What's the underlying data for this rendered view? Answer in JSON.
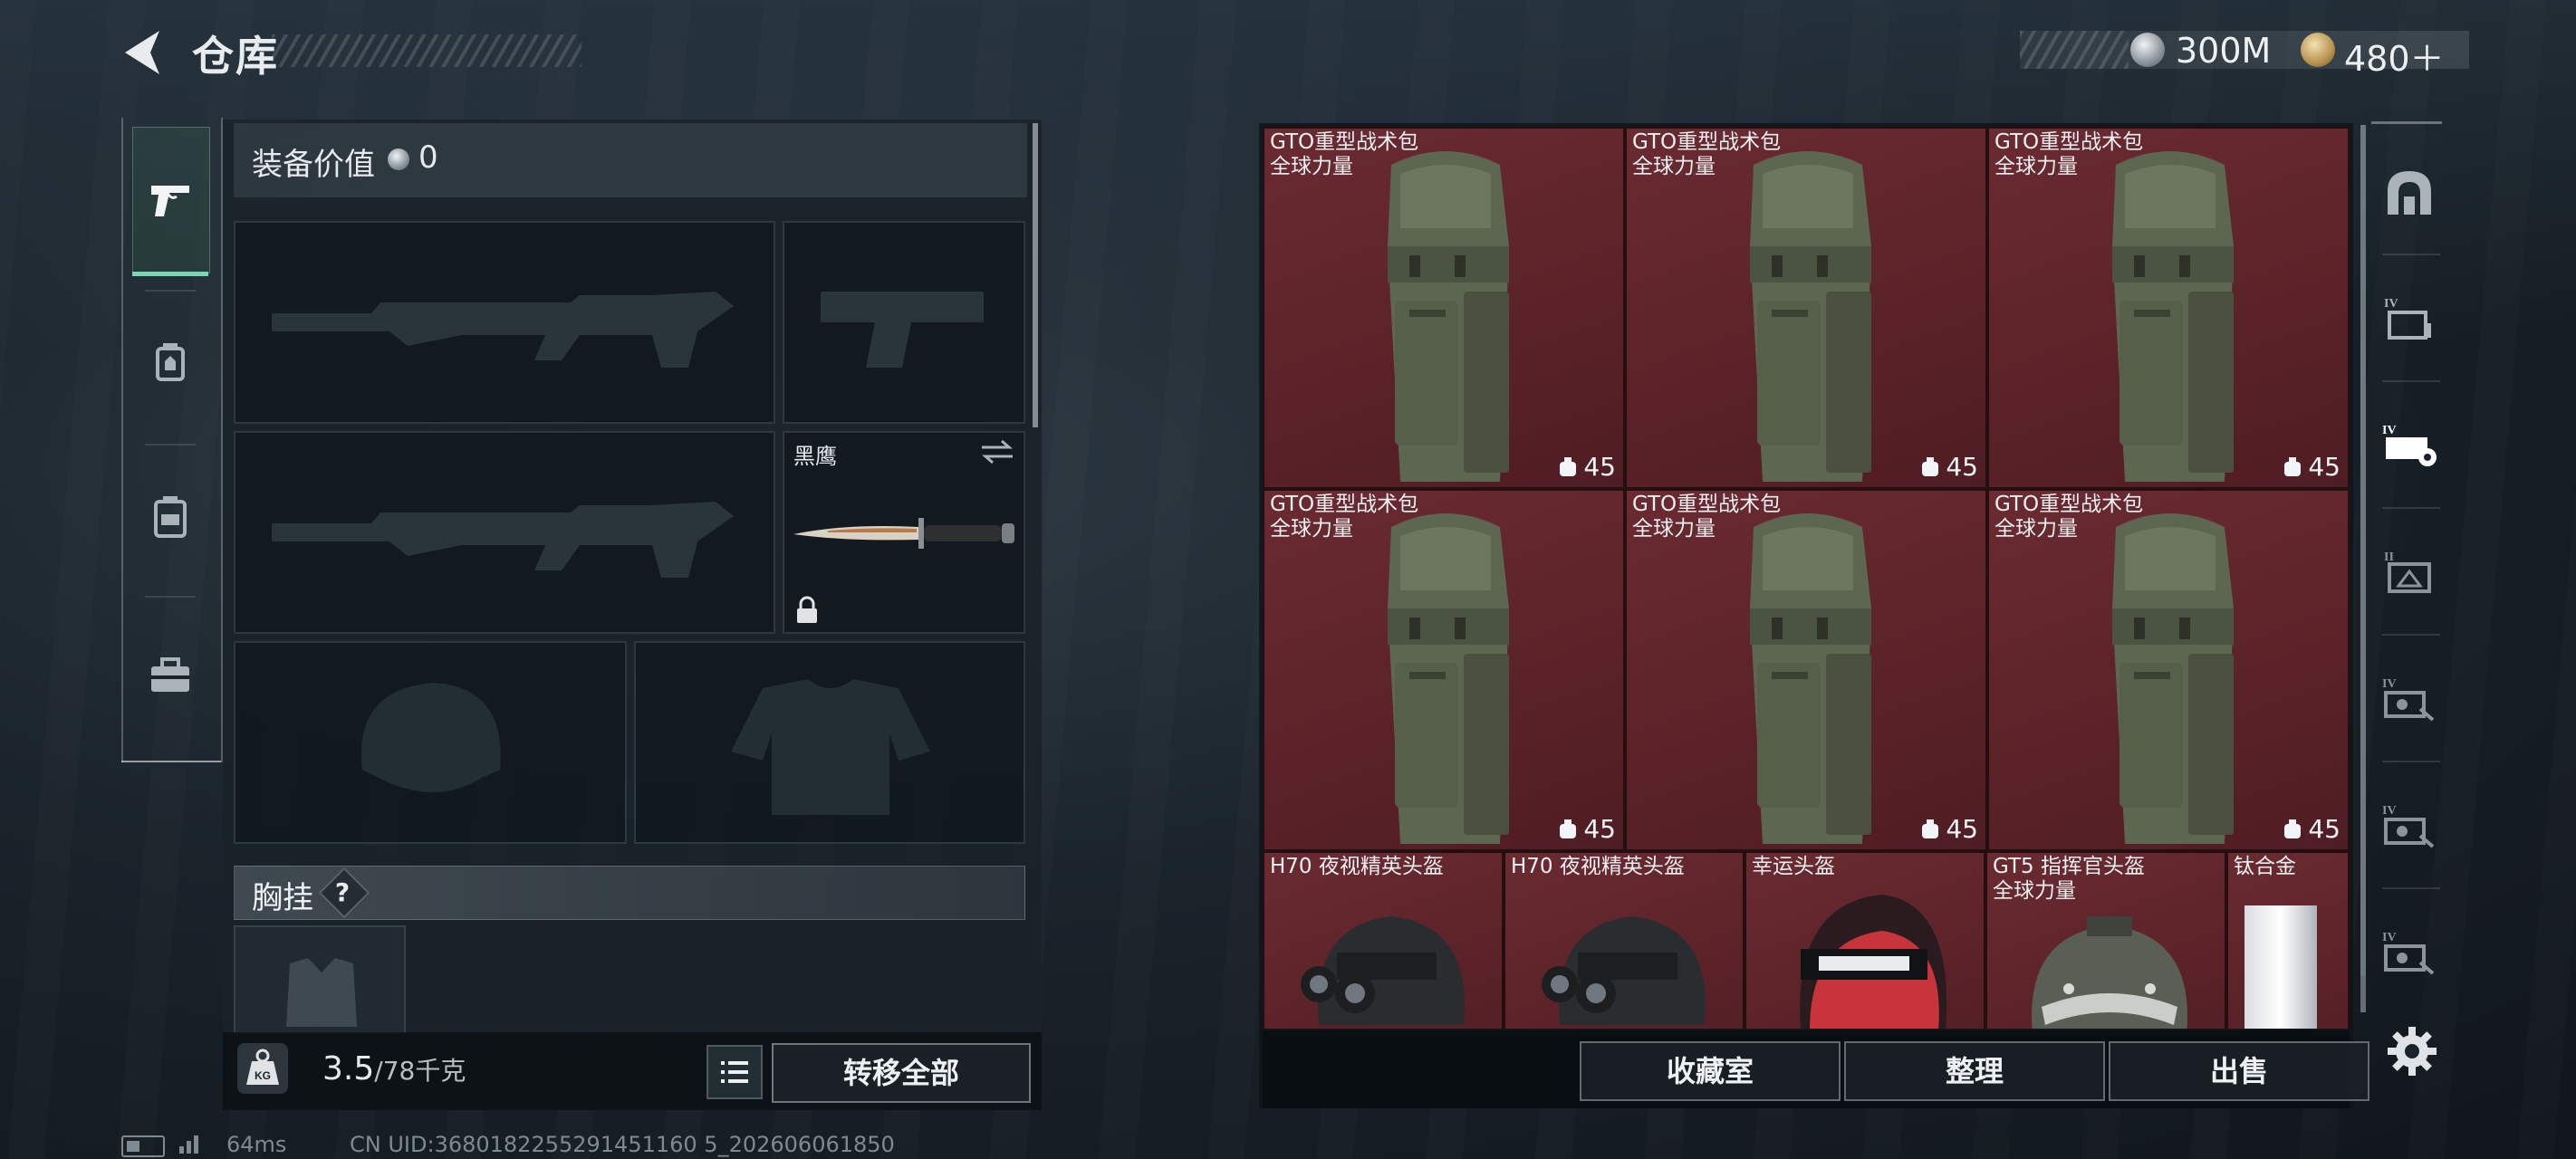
{
  "header": {
    "title": "仓库"
  },
  "currency": {
    "silver": "300M",
    "gold": "480＋"
  },
  "equipment": {
    "value_label": "装备价值",
    "value": "0",
    "knife_name": "黑鹰",
    "chest_label": "胸挂",
    "help": "?"
  },
  "weight": {
    "current": "3.5",
    "max": "/78千克"
  },
  "buttons": {
    "transfer_all": "转移全部",
    "collection": "收藏室",
    "organize": "整理",
    "sell": "出售"
  },
  "storage": {
    "backpacks": [
      {
        "name": "GTO重型战术包",
        "sub": "全球力量",
        "capacity": "45"
      },
      {
        "name": "GTO重型战术包",
        "sub": "全球力量",
        "capacity": "45"
      },
      {
        "name": "GTO重型战术包",
        "sub": "全球力量",
        "capacity": "45"
      },
      {
        "name": "GTO重型战术包",
        "sub": "全球力量",
        "capacity": "45"
      },
      {
        "name": "GTO重型战术包",
        "sub": "全球力量",
        "capacity": "45"
      },
      {
        "name": "GTO重型战术包",
        "sub": "全球力量",
        "capacity": "45"
      }
    ],
    "helmets": [
      {
        "name": "H70 夜视精英头盔",
        "sub": ""
      },
      {
        "name": "H70 夜视精英头盔",
        "sub": ""
      },
      {
        "name": "幸运头盔",
        "sub": ""
      },
      {
        "name": "GT5 指挥官头盔",
        "sub": "全球力量"
      },
      {
        "name": "钛合金",
        "sub": ""
      }
    ]
  },
  "footer": {
    "ping": "64ms",
    "uid": "CN UID:3680182255291451160 5_202606061850"
  },
  "colors": {
    "accent": "#78d6b0",
    "cell_bg": "#6a2b31"
  },
  "icons": [
    "back-icon",
    "pistol-icon",
    "vest-icon",
    "backpack-icon",
    "toolbox-icon",
    "helmet-category-icon",
    "ammo-box-icon",
    "armor-category-icon",
    "settings-icon"
  ]
}
